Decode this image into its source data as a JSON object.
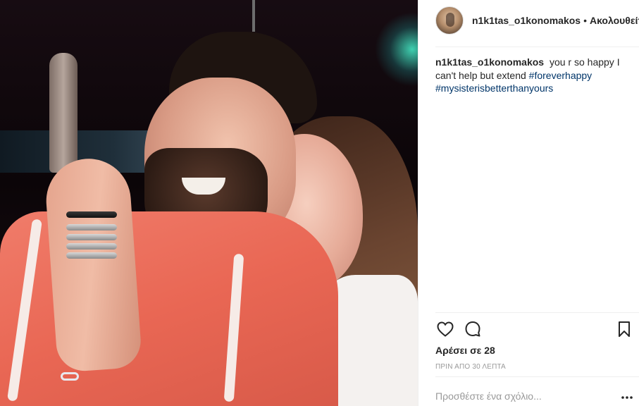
{
  "post": {
    "username": "n1k1tas_o1konomakos",
    "separator": "•",
    "follow_status": "Ακολουθείτε"
  },
  "caption": {
    "username": "n1k1tas_o1konomakos",
    "text": "you r so happy I can't help but extend",
    "hashtags": [
      "#foreverhappy",
      "#mysisterisbetterthanyours"
    ]
  },
  "actions": {
    "icons": [
      "heart-icon",
      "comment-icon",
      "bookmark-icon"
    ]
  },
  "likes": "Αρέσει σε 28",
  "timestamp": "ΠΡΙΝ ΑΠΟ 30 ΛΕΠΤΑ",
  "comment": {
    "placeholder": "Προσθέστε ένα σχόλιο...",
    "more_label": "..."
  },
  "colors": {
    "hashtag": "#003569",
    "text": "#262626",
    "muted": "#999999",
    "divider": "#efefef"
  }
}
